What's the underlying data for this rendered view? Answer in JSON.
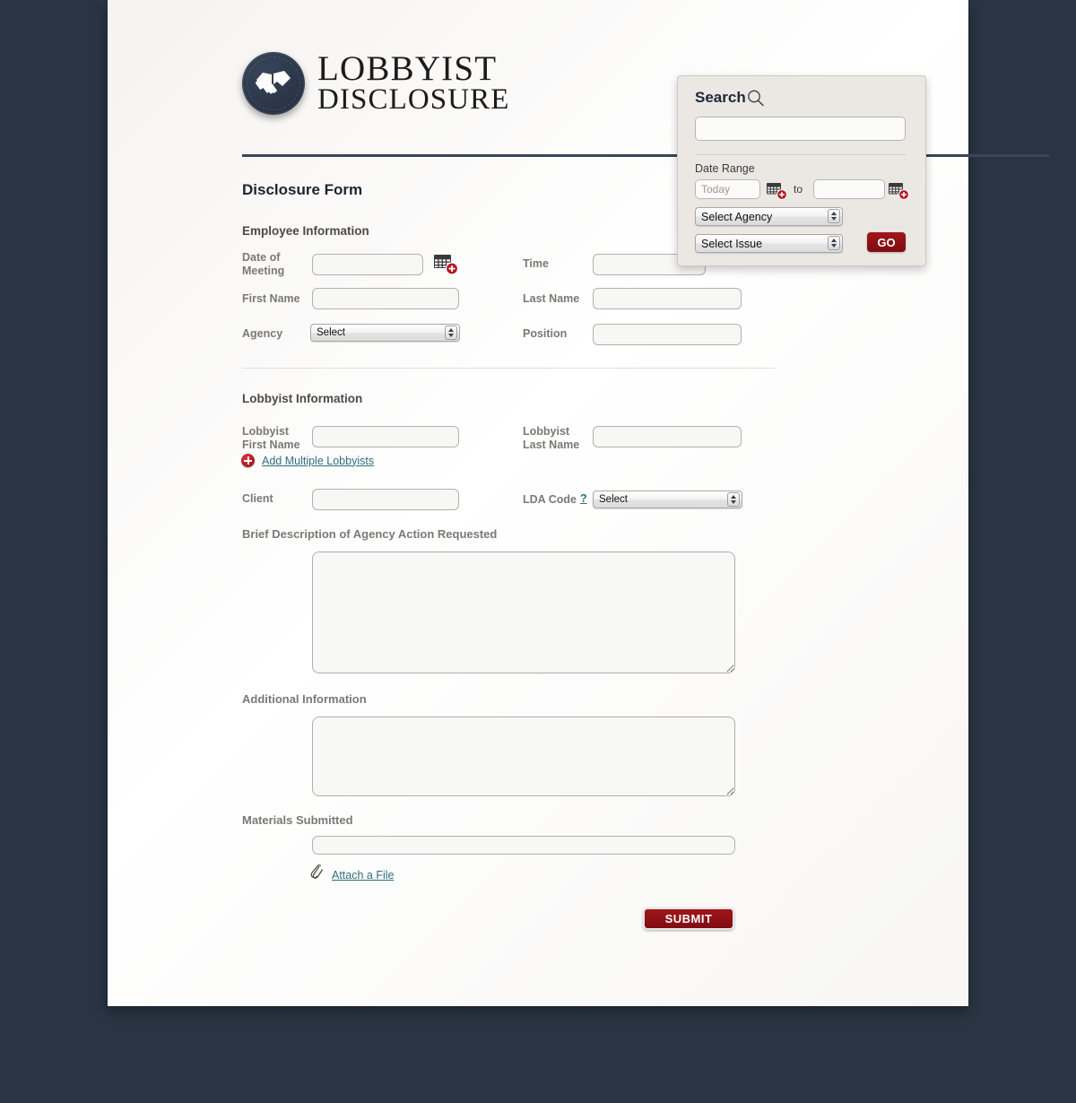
{
  "brand": {
    "line1": "LOBBYIST",
    "line2": "DISCLOSURE",
    "logo_icon": "handshake-icon"
  },
  "form": {
    "title": "Disclosure Form",
    "sections": {
      "employee": {
        "heading": "Employee Information",
        "fields": {
          "date_of_meeting": {
            "label": "Date of\nMeeting",
            "value": "",
            "placeholder": ""
          },
          "time": {
            "label": "Time",
            "value": "",
            "placeholder": ""
          },
          "first_name": {
            "label": "First Name",
            "value": "",
            "placeholder": ""
          },
          "last_name": {
            "label": "Last Name",
            "value": "",
            "placeholder": ""
          },
          "agency": {
            "label": "Agency",
            "selected": "Select"
          },
          "position": {
            "label": "Position",
            "value": "",
            "placeholder": ""
          }
        }
      },
      "lobbyist": {
        "heading": "Lobbyist Information",
        "fields": {
          "lobbyist_first_name": {
            "label": "Lobbyist\nFirst Name",
            "value": "",
            "placeholder": ""
          },
          "lobbyist_last_name": {
            "label": "Lobbyist\nLast Name",
            "value": "",
            "placeholder": ""
          },
          "client": {
            "label": "Client",
            "value": "",
            "placeholder": ""
          },
          "lda_code": {
            "label": "LDA Code",
            "help": "?",
            "selected": "Select"
          }
        },
        "add_multiple_link": "Add Multiple Lobbyists"
      }
    },
    "brief_description_label": "Brief Description of Agency Action Requested",
    "brief_description_value": "",
    "additional_info_label": "Additional Information",
    "additional_info_value": "",
    "materials_label": "Materials Submitted",
    "materials_value": "",
    "attach_link": "Attach a File",
    "submit_label": "SUBMIT"
  },
  "search": {
    "title": "Search",
    "query": "",
    "query_placeholder": "",
    "date_range_label": "Date Range",
    "date_from_placeholder": "Today",
    "date_from_value": "",
    "to_label": "to",
    "date_to_placeholder": "",
    "date_to_value": "",
    "agency_selected": "Select Agency",
    "issue_selected": "Select Issue",
    "go_label": "GO"
  },
  "icons": {
    "search": "magnifier-icon",
    "calendar_add": "calendar-add-icon",
    "plus": "plus-circle-icon",
    "paperclip": "paperclip-icon"
  },
  "colors": {
    "page_background": "#2a3443",
    "card_background": "#f7f6f4",
    "brand_navy": "#2b3648",
    "accent_red": "#8e1116",
    "link_teal": "#2f6e7c",
    "panel_background": "#ebe7e3"
  }
}
